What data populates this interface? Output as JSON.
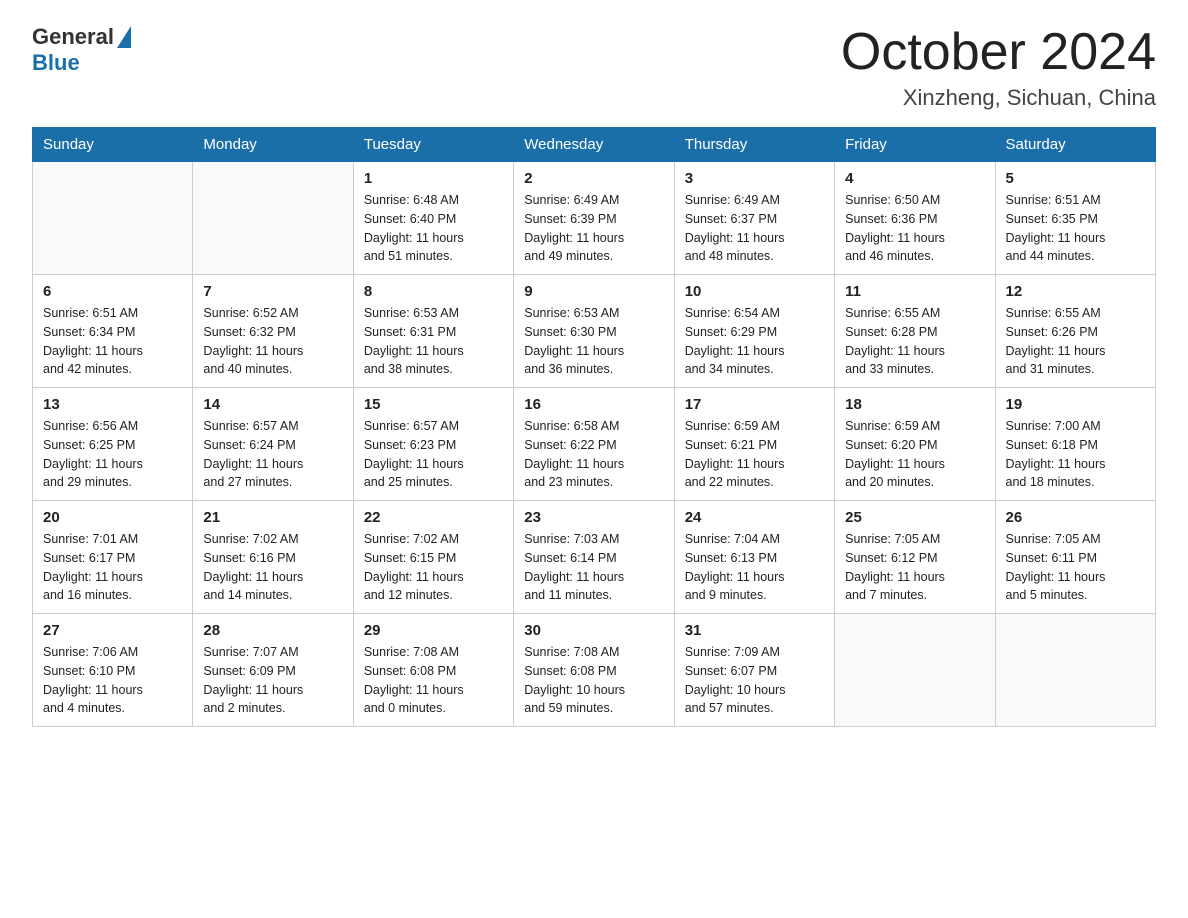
{
  "logo": {
    "general": "General",
    "blue": "Blue"
  },
  "title": "October 2024",
  "location": "Xinzheng, Sichuan, China",
  "days_of_week": [
    "Sunday",
    "Monday",
    "Tuesday",
    "Wednesday",
    "Thursday",
    "Friday",
    "Saturday"
  ],
  "weeks": [
    [
      {
        "day": "",
        "info": ""
      },
      {
        "day": "",
        "info": ""
      },
      {
        "day": "1",
        "info": "Sunrise: 6:48 AM\nSunset: 6:40 PM\nDaylight: 11 hours\nand 51 minutes."
      },
      {
        "day": "2",
        "info": "Sunrise: 6:49 AM\nSunset: 6:39 PM\nDaylight: 11 hours\nand 49 minutes."
      },
      {
        "day": "3",
        "info": "Sunrise: 6:49 AM\nSunset: 6:37 PM\nDaylight: 11 hours\nand 48 minutes."
      },
      {
        "day": "4",
        "info": "Sunrise: 6:50 AM\nSunset: 6:36 PM\nDaylight: 11 hours\nand 46 minutes."
      },
      {
        "day": "5",
        "info": "Sunrise: 6:51 AM\nSunset: 6:35 PM\nDaylight: 11 hours\nand 44 minutes."
      }
    ],
    [
      {
        "day": "6",
        "info": "Sunrise: 6:51 AM\nSunset: 6:34 PM\nDaylight: 11 hours\nand 42 minutes."
      },
      {
        "day": "7",
        "info": "Sunrise: 6:52 AM\nSunset: 6:32 PM\nDaylight: 11 hours\nand 40 minutes."
      },
      {
        "day": "8",
        "info": "Sunrise: 6:53 AM\nSunset: 6:31 PM\nDaylight: 11 hours\nand 38 minutes."
      },
      {
        "day": "9",
        "info": "Sunrise: 6:53 AM\nSunset: 6:30 PM\nDaylight: 11 hours\nand 36 minutes."
      },
      {
        "day": "10",
        "info": "Sunrise: 6:54 AM\nSunset: 6:29 PM\nDaylight: 11 hours\nand 34 minutes."
      },
      {
        "day": "11",
        "info": "Sunrise: 6:55 AM\nSunset: 6:28 PM\nDaylight: 11 hours\nand 33 minutes."
      },
      {
        "day": "12",
        "info": "Sunrise: 6:55 AM\nSunset: 6:26 PM\nDaylight: 11 hours\nand 31 minutes."
      }
    ],
    [
      {
        "day": "13",
        "info": "Sunrise: 6:56 AM\nSunset: 6:25 PM\nDaylight: 11 hours\nand 29 minutes."
      },
      {
        "day": "14",
        "info": "Sunrise: 6:57 AM\nSunset: 6:24 PM\nDaylight: 11 hours\nand 27 minutes."
      },
      {
        "day": "15",
        "info": "Sunrise: 6:57 AM\nSunset: 6:23 PM\nDaylight: 11 hours\nand 25 minutes."
      },
      {
        "day": "16",
        "info": "Sunrise: 6:58 AM\nSunset: 6:22 PM\nDaylight: 11 hours\nand 23 minutes."
      },
      {
        "day": "17",
        "info": "Sunrise: 6:59 AM\nSunset: 6:21 PM\nDaylight: 11 hours\nand 22 minutes."
      },
      {
        "day": "18",
        "info": "Sunrise: 6:59 AM\nSunset: 6:20 PM\nDaylight: 11 hours\nand 20 minutes."
      },
      {
        "day": "19",
        "info": "Sunrise: 7:00 AM\nSunset: 6:18 PM\nDaylight: 11 hours\nand 18 minutes."
      }
    ],
    [
      {
        "day": "20",
        "info": "Sunrise: 7:01 AM\nSunset: 6:17 PM\nDaylight: 11 hours\nand 16 minutes."
      },
      {
        "day": "21",
        "info": "Sunrise: 7:02 AM\nSunset: 6:16 PM\nDaylight: 11 hours\nand 14 minutes."
      },
      {
        "day": "22",
        "info": "Sunrise: 7:02 AM\nSunset: 6:15 PM\nDaylight: 11 hours\nand 12 minutes."
      },
      {
        "day": "23",
        "info": "Sunrise: 7:03 AM\nSunset: 6:14 PM\nDaylight: 11 hours\nand 11 minutes."
      },
      {
        "day": "24",
        "info": "Sunrise: 7:04 AM\nSunset: 6:13 PM\nDaylight: 11 hours\nand 9 minutes."
      },
      {
        "day": "25",
        "info": "Sunrise: 7:05 AM\nSunset: 6:12 PM\nDaylight: 11 hours\nand 7 minutes."
      },
      {
        "day": "26",
        "info": "Sunrise: 7:05 AM\nSunset: 6:11 PM\nDaylight: 11 hours\nand 5 minutes."
      }
    ],
    [
      {
        "day": "27",
        "info": "Sunrise: 7:06 AM\nSunset: 6:10 PM\nDaylight: 11 hours\nand 4 minutes."
      },
      {
        "day": "28",
        "info": "Sunrise: 7:07 AM\nSunset: 6:09 PM\nDaylight: 11 hours\nand 2 minutes."
      },
      {
        "day": "29",
        "info": "Sunrise: 7:08 AM\nSunset: 6:08 PM\nDaylight: 11 hours\nand 0 minutes."
      },
      {
        "day": "30",
        "info": "Sunrise: 7:08 AM\nSunset: 6:08 PM\nDaylight: 10 hours\nand 59 minutes."
      },
      {
        "day": "31",
        "info": "Sunrise: 7:09 AM\nSunset: 6:07 PM\nDaylight: 10 hours\nand 57 minutes."
      },
      {
        "day": "",
        "info": ""
      },
      {
        "day": "",
        "info": ""
      }
    ]
  ]
}
